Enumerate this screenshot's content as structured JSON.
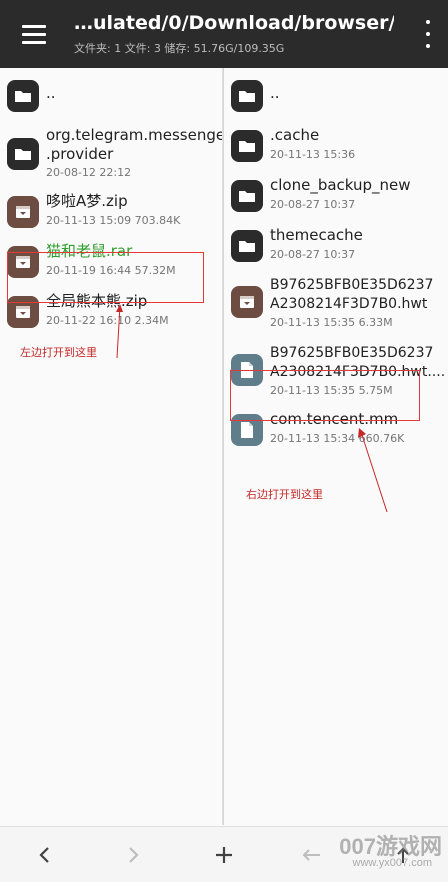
{
  "appbar": {
    "title": "…ulated/0/Download/browser/",
    "subtitle": "文件夹: 1  文件: 3  储存: 51.76G/109.35G"
  },
  "left_pane": {
    "items": [
      {
        "name": "..",
        "meta": "",
        "icon": "folder-icon"
      },
      {
        "name": "org.telegram.messenger",
        "name2": ".provider",
        "meta": "20-08-12 22:12",
        "icon": "folder-icon"
      },
      {
        "name": "哆啦A梦.zip",
        "meta": "20-11-13 15:09  703.84K",
        "icon": "archive-icon"
      },
      {
        "name": "猫和老鼠.rar",
        "meta": "20-11-19 16:44  57.32M",
        "icon": "archive-icon"
      },
      {
        "name": "全局熊本熊.zip",
        "meta": "20-11-22 16:10  2.34M",
        "icon": "archive-icon"
      }
    ],
    "annotation": "左边打开到这里"
  },
  "right_pane": {
    "items": [
      {
        "name": "..",
        "meta": "",
        "icon": "folder-icon"
      },
      {
        "name": ".cache",
        "meta": "20-11-13 15:36",
        "icon": "folder-icon"
      },
      {
        "name": "clone_backup_new",
        "meta": "20-08-27 10:37",
        "icon": "folder-icon"
      },
      {
        "name": "themecache",
        "meta": "20-08-27 10:37",
        "icon": "folder-icon"
      },
      {
        "name": "B97625BFB0E35D6237",
        "name2": "A2308214F3D7B0.hwt",
        "meta": "20-11-13 15:35  6.33M",
        "icon": "archive-icon"
      },
      {
        "name": "B97625BFB0E35D6237",
        "name2": "A2308214F3D7B0.hwt....",
        "meta": "20-11-13 15:35  5.75M",
        "icon": "file-icon"
      },
      {
        "name": "com.tencent.mm",
        "meta": "20-11-13 15:34  660.76K",
        "icon": "file-icon"
      }
    ],
    "annotation": "右边打开到这里"
  },
  "bottombar": {
    "back": "‹",
    "forward": "›",
    "add": "+"
  },
  "watermark": {
    "main": "007游戏网",
    "sub": "www.yx007.com"
  },
  "colors": {
    "appbar_bg": "#2b2b2b",
    "folder_icon": "#2b2b2b",
    "archive_icon": "#6d4c41",
    "file_icon": "#607d8b",
    "annotation_red": "#e53935",
    "rar_name_green": "#2e9e2e"
  }
}
